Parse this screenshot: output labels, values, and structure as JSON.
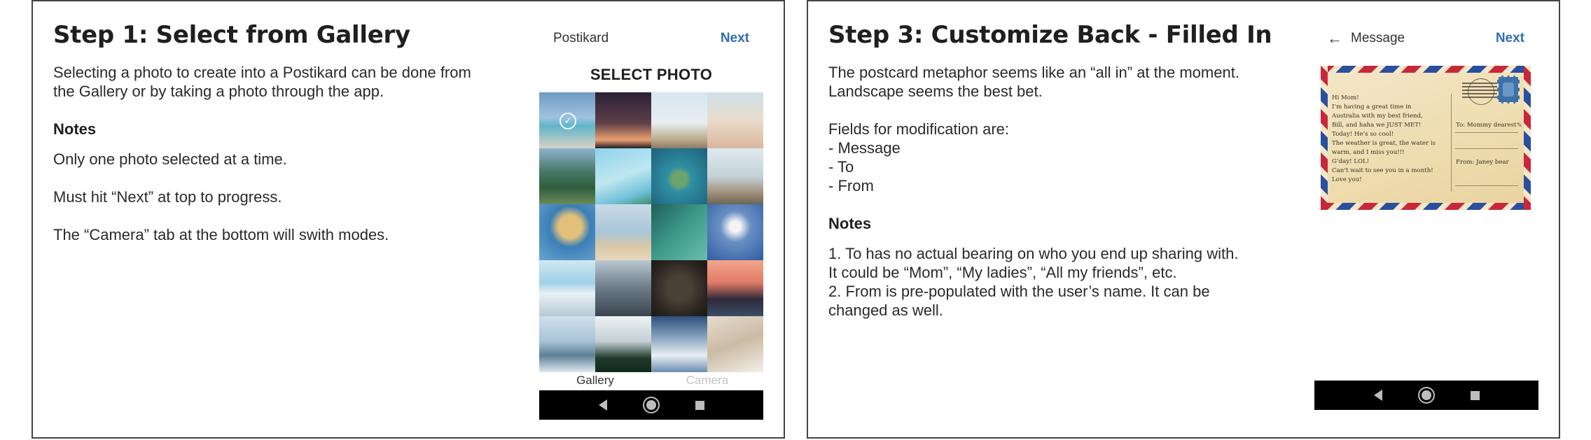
{
  "slide1": {
    "title": "Step 1: Select from Gallery",
    "description": "Selecting a photo to create into a Postikard can be done from the Gallery or by taking a photo through the app.",
    "notes_heading": "Notes",
    "notes": [
      "Only one photo selected at a time.",
      "Must hit “Next” at top to progress.",
      "The “Camera” tab at the bottom will swith modes."
    ],
    "phone": {
      "header_title": "Postikard",
      "next_label": "Next",
      "section_title": "SELECT PHOTO",
      "tabs": [
        "Gallery",
        "Camera"
      ],
      "active_tab": "Gallery",
      "photo_count": 20,
      "selected_photo": 1
    }
  },
  "slide2": {
    "title": "Step 3: Customize Back - Filled In",
    "description": "The postcard metaphor seems like an “all in” at the moment. Landscape seems the best bet.",
    "fields_intro": "Fields for modification are:\n- Message\n- To\n- From",
    "notes_heading": "Notes",
    "notes": [
      "1. To has no actual bearing on who you end up sharing with. It could be “Mom”, “My ladies”, “All my friends”, etc.\n2. From is pre-populated with the user’s name. It can be changed as well."
    ],
    "phone": {
      "header_title": "Message",
      "next_label": "Next",
      "postcard": {
        "message": "Hi Mom!\nI’m having a great time in\nAustralia with my best friend,\nBill, and haha we JUST MET!\nToday! He’s so cool!\nThe weather is great, the water is\nwarm, and I miss you!!!\nG’day! LOL!\nCan’t wait to see you in a month!\nLove you!",
        "to": "To: Mommy dearest",
        "from": "From: Janey bear"
      }
    }
  },
  "colors": {
    "accent": "#2f6fb0",
    "nav_bar": "#000000",
    "inactive_tab": "#c4c4c4"
  },
  "icons": {
    "back_arrow": "←",
    "selected_check": "✓"
  }
}
